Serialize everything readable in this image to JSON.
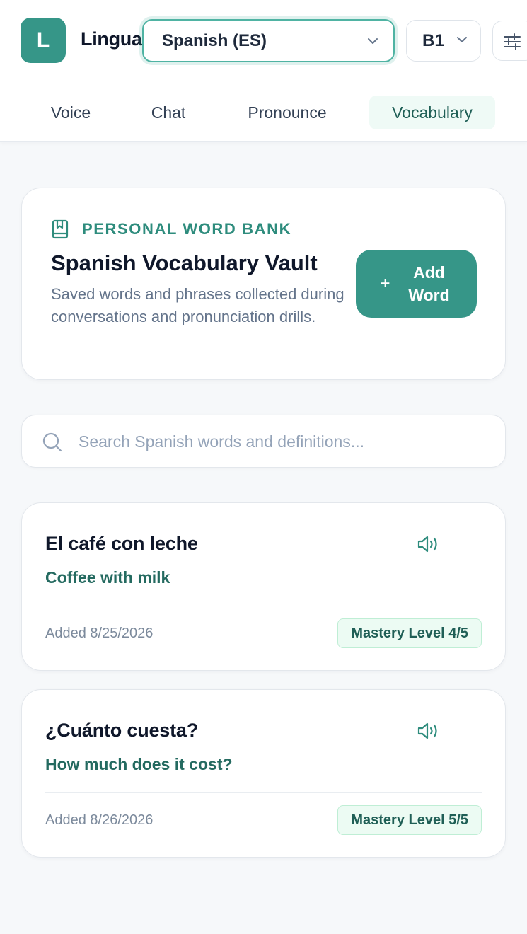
{
  "app": {
    "logo_letter": "L",
    "name": "Lingua"
  },
  "header": {
    "language": "Spanish (ES)",
    "level": "B1",
    "tabs": [
      {
        "label": "Voice",
        "active": false
      },
      {
        "label": "Chat",
        "active": false
      },
      {
        "label": "Pronounce",
        "active": false
      },
      {
        "label": "Vocabulary",
        "active": true
      }
    ]
  },
  "hero": {
    "eyebrow": "PERSONAL WORD BANK",
    "title": "Spanish Vocabulary Vault",
    "description": "Saved words and phrases collected during conversations and pronunciation drills.",
    "add_plus": "+",
    "add_label": "Add Word"
  },
  "search": {
    "placeholder": "Search Spanish words and definitions...",
    "value": ""
  },
  "words": [
    {
      "term": "El café con leche",
      "definition": "Coffee with milk",
      "added": "Added 8/25/2026",
      "mastery": "Mastery Level 4/5"
    },
    {
      "term": "¿Cuánto cuesta?",
      "definition": "How much does it cost?",
      "added": "Added 8/26/2026",
      "mastery": "Mastery Level 5/5"
    }
  ],
  "colors": {
    "accent": "#369688",
    "accent_dark": "#1f5f56",
    "background": "#f6f8fa"
  }
}
